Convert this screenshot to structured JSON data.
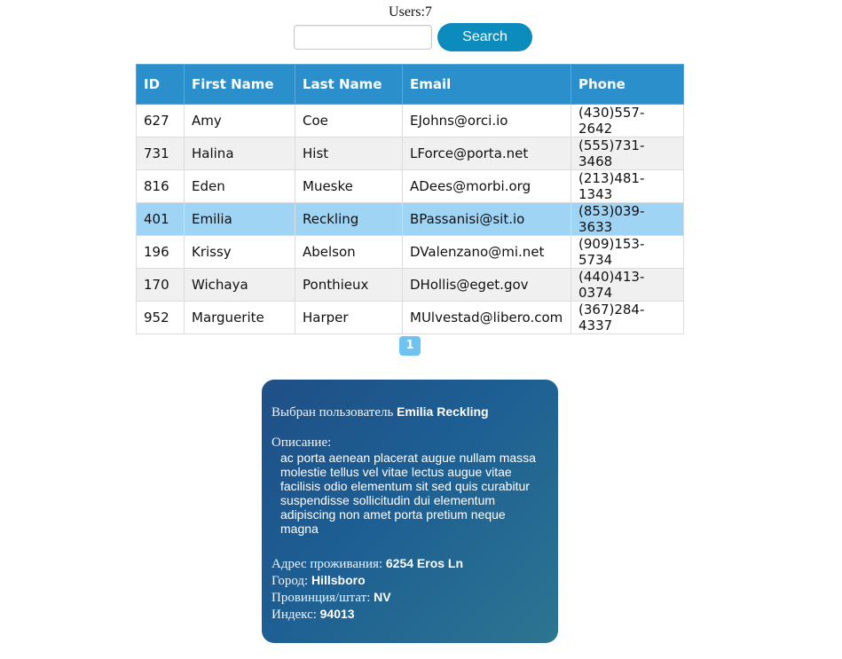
{
  "header": {
    "users_label": "Users:7"
  },
  "search": {
    "value": "",
    "placeholder": "",
    "button_label": "Search"
  },
  "table": {
    "columns": [
      "ID",
      "First Name",
      "Last Name",
      "Email",
      "Phone"
    ],
    "rows": [
      {
        "id": "627",
        "first": "Amy",
        "last": "Coe",
        "email": "EJohns@orci.io",
        "phone": "(430)557-2642"
      },
      {
        "id": "731",
        "first": "Halina",
        "last": "Hist",
        "email": "LForce@porta.net",
        "phone": "(555)731-3468"
      },
      {
        "id": "816",
        "first": "Eden",
        "last": "Mueske",
        "email": "ADees@morbi.org",
        "phone": "(213)481-1343"
      },
      {
        "id": "401",
        "first": "Emilia",
        "last": "Reckling",
        "email": "BPassanisi@sit.io",
        "phone": "(853)039-3633"
      },
      {
        "id": "196",
        "first": "Krissy",
        "last": "Abelson",
        "email": "DValenzano@mi.net",
        "phone": "(909)153-5734"
      },
      {
        "id": "170",
        "first": "Wichaya",
        "last": "Ponthieux",
        "email": "DHollis@eget.gov",
        "phone": "(440)413-0374"
      },
      {
        "id": "952",
        "first": "Marguerite",
        "last": "Harper",
        "email": "MUlvestad@libero.com",
        "phone": "(367)284-4337"
      }
    ],
    "selected_row_index": 3
  },
  "pagination": {
    "current_page": "1"
  },
  "details": {
    "selected_label": "Выбран пользователь",
    "selected_name": "Emilia Reckling",
    "description_label": "Описание:",
    "description_text": "ac porta aenean placerat augue nullam massa molestie tellus vel vitae lectus augue vitae facilisis odio elementum sit sed quis curabitur suspendisse sollicitudin dui elementum adipiscing non amet porta pretium neque magna",
    "address_label": "Адрес проживания:",
    "address_value": "6254 Eros Ln",
    "city_label": "Город:",
    "city_value": "Hillsboro",
    "state_label": "Провинция/штат:",
    "state_value": "NV",
    "zip_label": "Индекс:",
    "zip_value": "94013"
  },
  "colors": {
    "header_bg": "#2a8fcb",
    "button_bg": "#0c8bbd",
    "selected_row": "#9fd4f5",
    "page_button": "#6fc3f2",
    "card_gradient_start": "#1f4f86",
    "card_gradient_end": "#2d7591"
  }
}
